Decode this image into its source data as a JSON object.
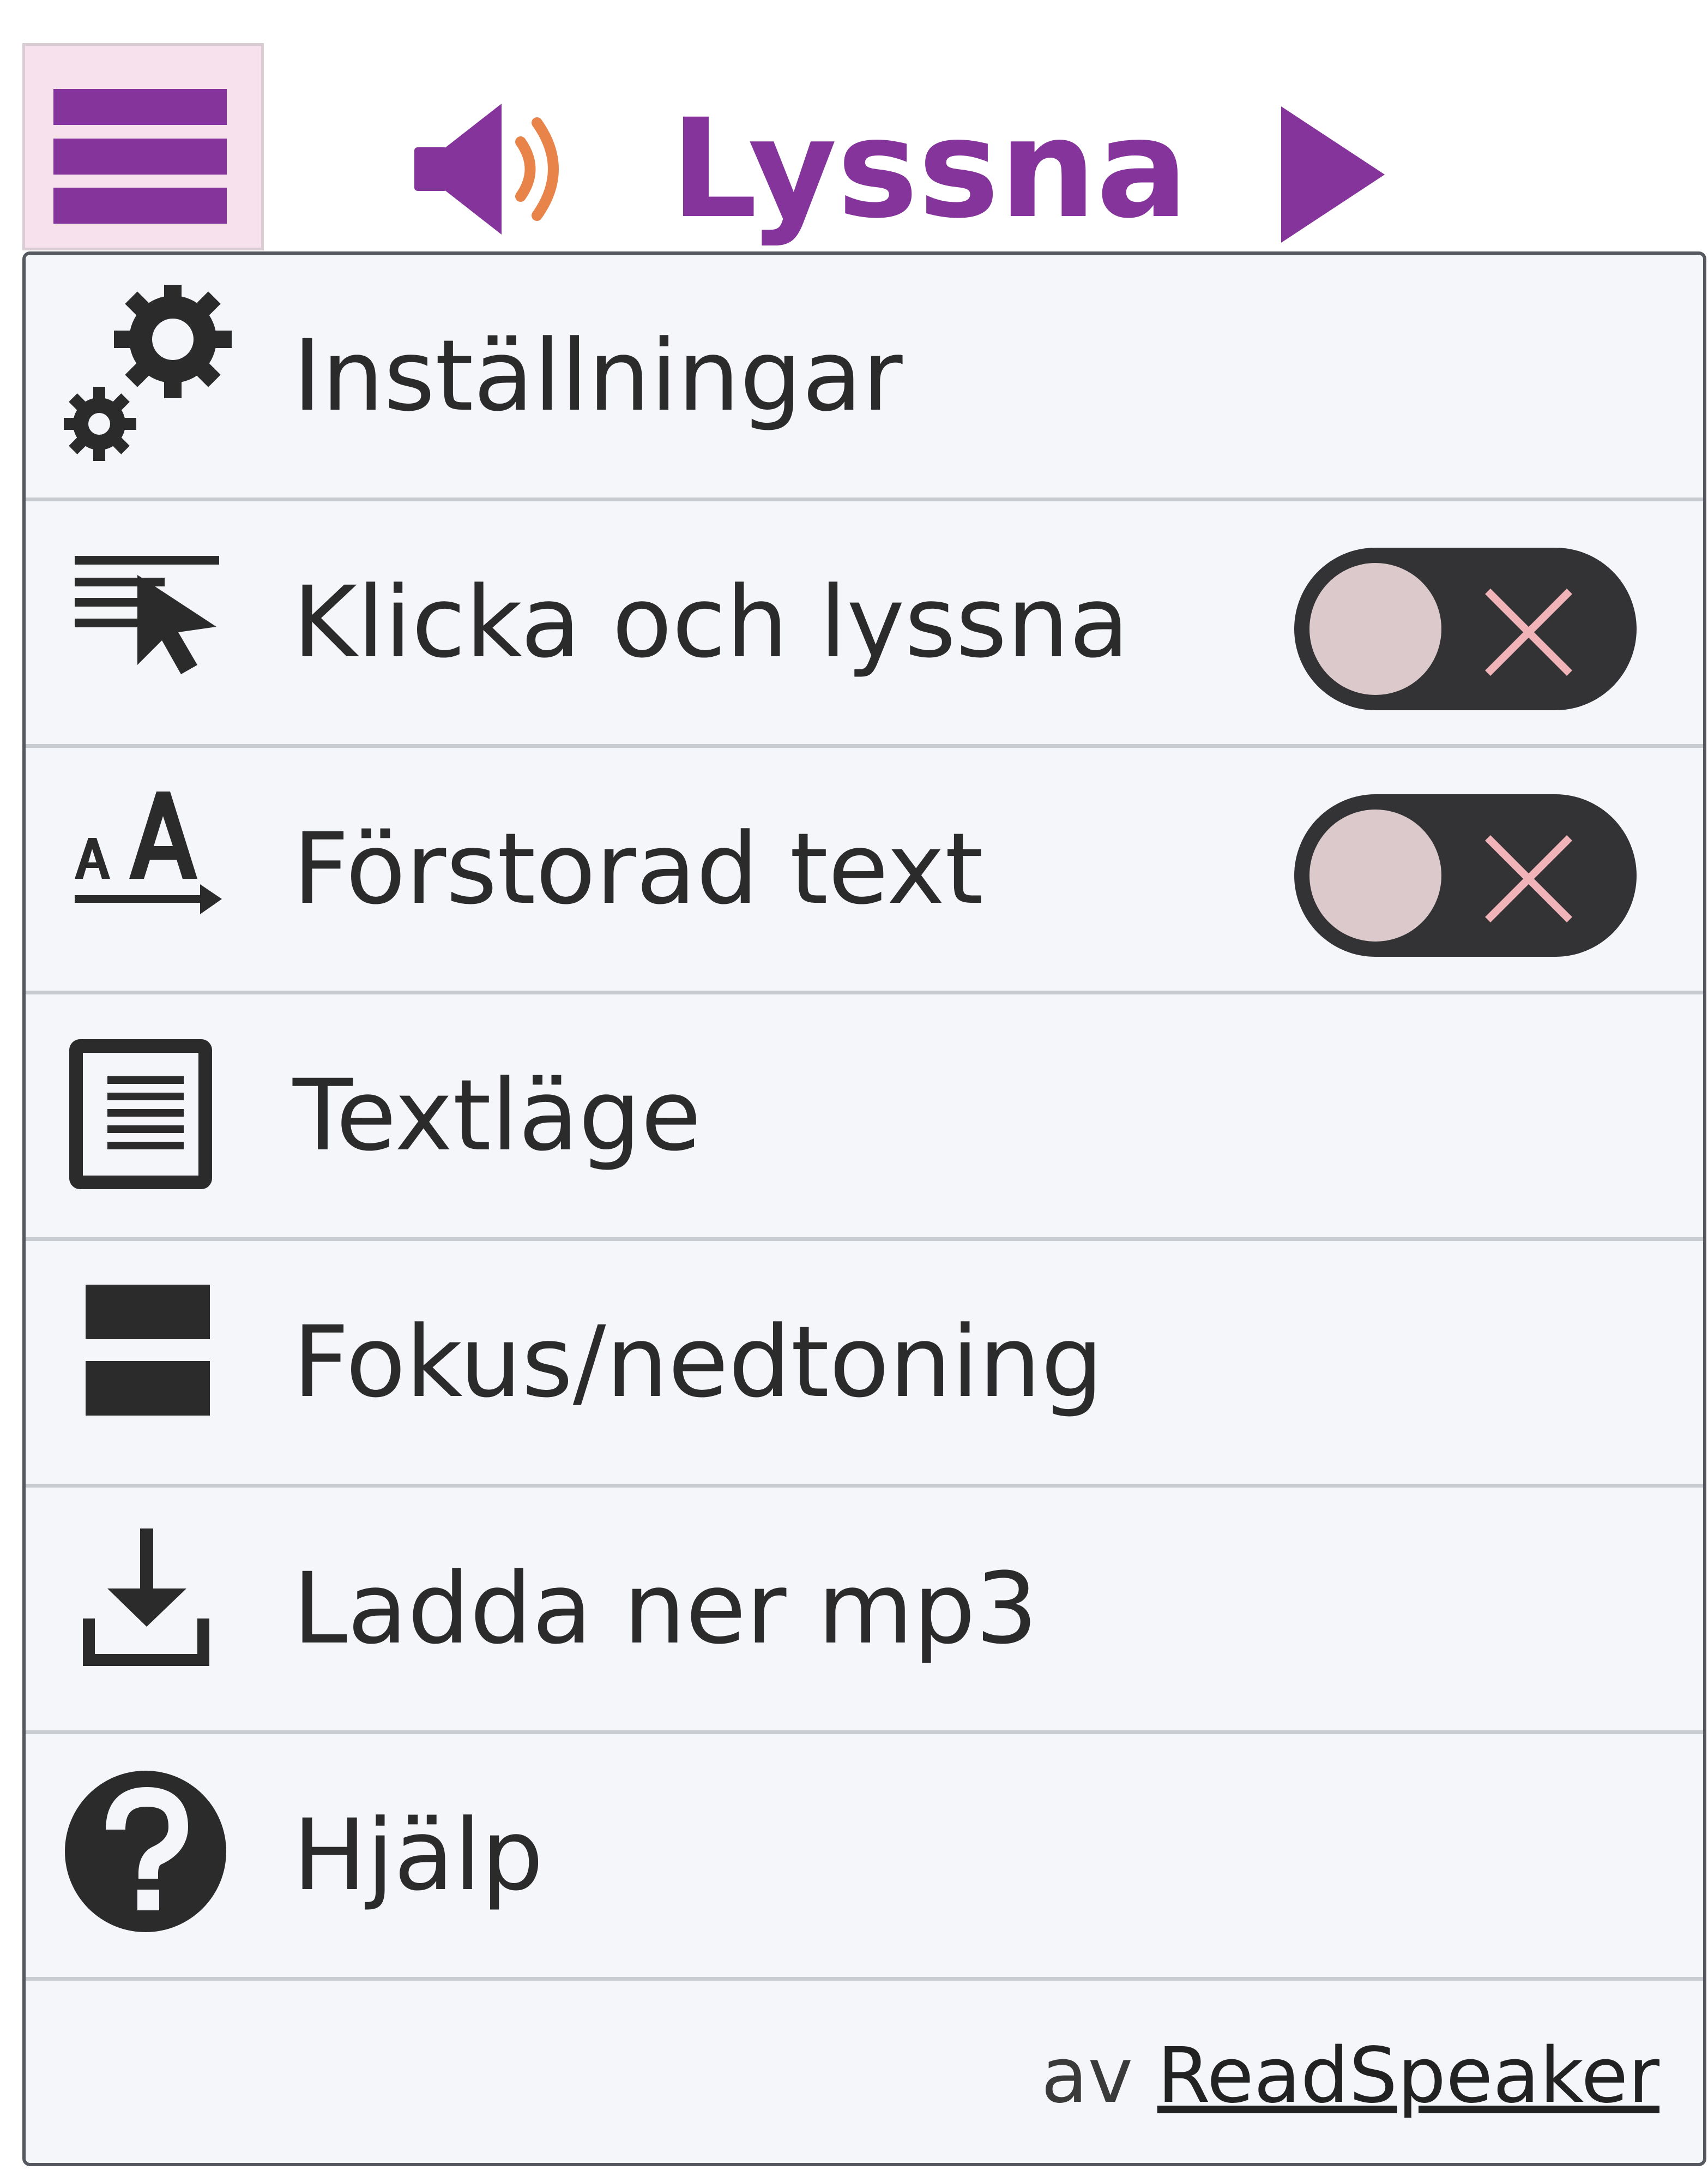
{
  "player": {
    "listen_label": "Lyssna"
  },
  "menu": {
    "items": [
      {
        "label": "Inställningar",
        "icon": "gears-icon"
      },
      {
        "label": "Klicka och lyssna",
        "icon": "click-and-listen-icon",
        "toggle": "off"
      },
      {
        "label": "Förstorad text",
        "icon": "enlarge-text-icon",
        "toggle": "off"
      },
      {
        "label": "Textläge",
        "icon": "text-mode-icon"
      },
      {
        "label": "Fokus/nedtoning",
        "icon": "focus-dimming-icon"
      },
      {
        "label": "Ladda ner mp3",
        "icon": "download-icon"
      },
      {
        "label": "Hjälp",
        "icon": "help-icon"
      }
    ],
    "footer": {
      "prefix": "av",
      "link": "ReadSpeaker"
    }
  },
  "colors": {
    "accent_purple": "#85349b",
    "speaker_waves": "#e8844a",
    "menu_button_bg": "#f7e1ec",
    "dropdown_bg": "#f4f6fa",
    "icon_dark": "#2b2b2b",
    "toggle_bg": "#333335",
    "toggle_knob": "#dcc9cb",
    "toggle_x": "#f0b3b8"
  }
}
